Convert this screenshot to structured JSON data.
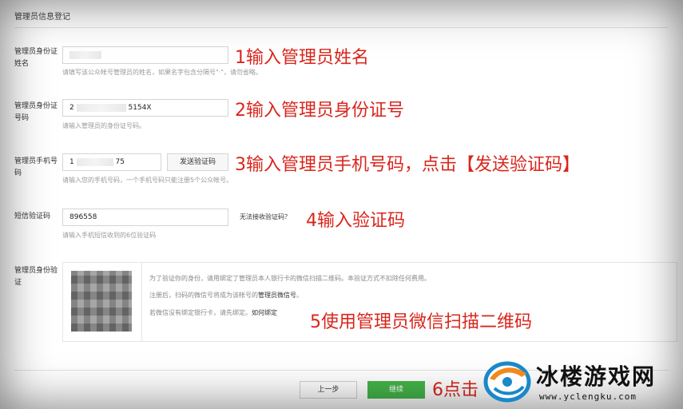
{
  "header": {
    "title": "管理员信息登记"
  },
  "fields": {
    "name": {
      "label": "管理员身份证姓名",
      "hint": "请填写该公众帐号管理员的姓名，如果名字包含分隔号\"·\"，请勿省略。",
      "annotation": "1输入管理员姓名"
    },
    "id": {
      "label": "管理员身份证号码",
      "value_prefix": "2",
      "value_suffix": "5154X",
      "hint": "请输入管理员的身份证号码。",
      "annotation": "2输入管理员身份证号"
    },
    "phone": {
      "label": "管理员手机号码",
      "value_prefix": "1",
      "value_suffix": "75",
      "send_button": "发送验证码",
      "hint": "请输入您的手机号码，一个手机号码只能注册5个公众帐号。",
      "annotation": "3输入管理员手机号码，点击【发送验证码】"
    },
    "sms": {
      "label": "短信验证码",
      "value": "896558",
      "link": "无法接收验证码？",
      "hint": "请输入手机短信收到的6位验证码",
      "annotation": "4输入验证码"
    },
    "verify": {
      "label": "管理员身份验证",
      "line1": "为了验证你的身份，请用绑定了管理员本人银行卡的微信扫描二维码。本验证方式不扣除任何费用。",
      "line2_a": "注册后，扫码的微信号将成为该帐号的",
      "line2_b": "管理员微信号",
      "line2_c": "。",
      "line3_a": "若微信没有绑定银行卡，请先绑定。",
      "line3_b": "如何绑定",
      "annotation": "5使用管理员微信扫描二维码"
    }
  },
  "footer": {
    "prev": "上一步",
    "next": "继续",
    "annotation": "6点击"
  },
  "watermark": {
    "title": "冰楼游戏网",
    "url": "www.yclengku.com"
  },
  "colors": {
    "annotation": "#d9261c",
    "primary_button": "#44b549"
  }
}
